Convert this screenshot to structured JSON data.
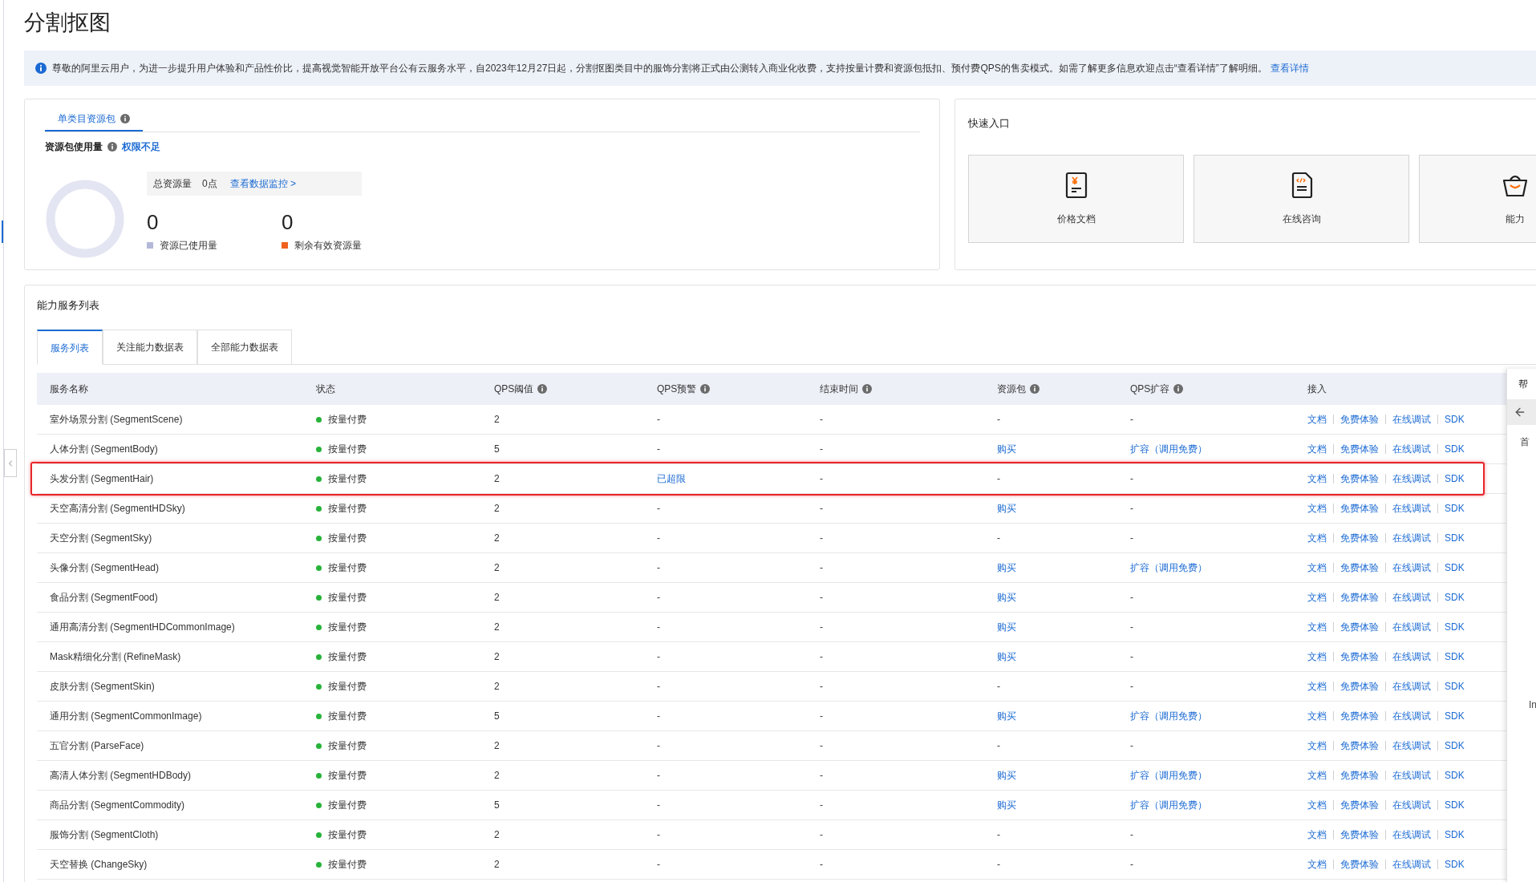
{
  "page_title": "分割抠图",
  "notice": {
    "text": "尊敬的阿里云用户，为进一步提升用户体验和产品性价比，提高视觉智能开放平台公有云服务水平，自2023年12月27日起，分割抠图类目中的服饰分割将正式由公测转入商业化收费，支持按量计费和资源包抵扣、预付费QPS的售卖模式。如需了解更多信息欢迎点击“查看详情”了解明细。",
    "link": "查看详情"
  },
  "resource_card": {
    "tabs": [
      {
        "label": "单类目资源包",
        "selected": true
      }
    ],
    "usage_label": "资源包使用量",
    "permission_link": "权限不足",
    "total_label": "总资源量",
    "total_value": "0点",
    "monitor_link": "查看数据监控 >",
    "used_value": "0",
    "used_label": "资源已使用量",
    "remaining_value": "0",
    "remaining_label": "剩余有效资源量"
  },
  "quick_entry": {
    "title": "快速入口",
    "tiles": [
      {
        "label": "价格文档",
        "kind": "price"
      },
      {
        "label": "在线咨询",
        "kind": "code"
      },
      {
        "label": "能力",
        "kind": "basket"
      }
    ]
  },
  "service_list": {
    "title": "能力服务列表",
    "tabs": [
      {
        "label": "服务列表",
        "selected": true
      },
      {
        "label": "关注能力数据表",
        "selected": false
      },
      {
        "label": "全部能力数据表",
        "selected": false
      }
    ],
    "columns": [
      {
        "label": "服务名称",
        "kind": "plain"
      },
      {
        "label": "状态",
        "kind": "plain"
      },
      {
        "label": "QPS阈值",
        "kind": "info"
      },
      {
        "label": "QPS预警",
        "kind": "info"
      },
      {
        "label": "结束时间",
        "kind": "info"
      },
      {
        "label": "资源包",
        "kind": "info"
      },
      {
        "label": "QPS扩容",
        "kind": "info"
      },
      {
        "label": "接入",
        "kind": "plain"
      }
    ],
    "rows": [
      {
        "name": "室外场景分割 (SegmentScene)",
        "status": "按量付费",
        "qps": "2",
        "warning": {
          "text": "-",
          "link": false
        },
        "end_time": "-",
        "package": {
          "text": "-",
          "link": false
        },
        "expand": {
          "text": "-",
          "link": false
        },
        "access": [
          "文档",
          "免费体验",
          "在线调试",
          "SDK"
        ],
        "highlighted": false
      },
      {
        "name": "人体分割 (SegmentBody)",
        "status": "按量付费",
        "qps": "5",
        "warning": {
          "text": "-",
          "link": false
        },
        "end_time": "-",
        "package": {
          "text": "购买",
          "link": true
        },
        "expand": {
          "text": "扩容（调用免费）",
          "link": true
        },
        "access": [
          "文档",
          "免费体验",
          "在线调试",
          "SDK"
        ],
        "highlighted": false
      },
      {
        "name": "头发分割 (SegmentHair)",
        "status": "按量付费",
        "qps": "2",
        "warning": {
          "text": "已超限",
          "link": true
        },
        "end_time": "-",
        "package": {
          "text": "-",
          "link": false
        },
        "expand": {
          "text": "-",
          "link": false
        },
        "access": [
          "文档",
          "免费体验",
          "在线调试",
          "SDK"
        ],
        "highlighted": true
      },
      {
        "name": "天空高清分割 (SegmentHDSky)",
        "status": "按量付费",
        "qps": "2",
        "warning": {
          "text": "-",
          "link": false
        },
        "end_time": "-",
        "package": {
          "text": "购买",
          "link": true
        },
        "expand": {
          "text": "-",
          "link": false
        },
        "access": [
          "文档",
          "免费体验",
          "在线调试",
          "SDK"
        ],
        "highlighted": false
      },
      {
        "name": "天空分割 (SegmentSky)",
        "status": "按量付费",
        "qps": "2",
        "warning": {
          "text": "-",
          "link": false
        },
        "end_time": "-",
        "package": {
          "text": "-",
          "link": false
        },
        "expand": {
          "text": "-",
          "link": false
        },
        "access": [
          "文档",
          "免费体验",
          "在线调试",
          "SDK"
        ],
        "highlighted": false
      },
      {
        "name": "头像分割 (SegmentHead)",
        "status": "按量付费",
        "qps": "2",
        "warning": {
          "text": "-",
          "link": false
        },
        "end_time": "-",
        "package": {
          "text": "购买",
          "link": true
        },
        "expand": {
          "text": "扩容（调用免费）",
          "link": true
        },
        "access": [
          "文档",
          "免费体验",
          "在线调试",
          "SDK"
        ],
        "highlighted": false
      },
      {
        "name": "食品分割 (SegmentFood)",
        "status": "按量付费",
        "qps": "2",
        "warning": {
          "text": "-",
          "link": false
        },
        "end_time": "-",
        "package": {
          "text": "购买",
          "link": true
        },
        "expand": {
          "text": "-",
          "link": false
        },
        "access": [
          "文档",
          "免费体验",
          "在线调试",
          "SDK"
        ],
        "highlighted": false
      },
      {
        "name": "通用高清分割 (SegmentHDCommonImage)",
        "status": "按量付费",
        "qps": "2",
        "warning": {
          "text": "-",
          "link": false
        },
        "end_time": "-",
        "package": {
          "text": "购买",
          "link": true
        },
        "expand": {
          "text": "-",
          "link": false
        },
        "access": [
          "文档",
          "免费体验",
          "在线调试",
          "SDK"
        ],
        "highlighted": false
      },
      {
        "name": "Mask精细化分割 (RefineMask)",
        "status": "按量付费",
        "qps": "2",
        "warning": {
          "text": "-",
          "link": false
        },
        "end_time": "-",
        "package": {
          "text": "购买",
          "link": true
        },
        "expand": {
          "text": "-",
          "link": false
        },
        "access": [
          "文档",
          "免费体验",
          "在线调试",
          "SDK"
        ],
        "highlighted": false
      },
      {
        "name": "皮肤分割 (SegmentSkin)",
        "status": "按量付费",
        "qps": "2",
        "warning": {
          "text": "-",
          "link": false
        },
        "end_time": "-",
        "package": {
          "text": "-",
          "link": false
        },
        "expand": {
          "text": "-",
          "link": false
        },
        "access": [
          "文档",
          "免费体验",
          "在线调试",
          "SDK"
        ],
        "highlighted": false
      },
      {
        "name": "通用分割 (SegmentCommonImage)",
        "status": "按量付费",
        "qps": "5",
        "warning": {
          "text": "-",
          "link": false
        },
        "end_time": "-",
        "package": {
          "text": "购买",
          "link": true
        },
        "expand": {
          "text": "扩容（调用免费）",
          "link": true
        },
        "access": [
          "文档",
          "免费体验",
          "在线调试",
          "SDK"
        ],
        "highlighted": false
      },
      {
        "name": "五官分割 (ParseFace)",
        "status": "按量付费",
        "qps": "2",
        "warning": {
          "text": "-",
          "link": false
        },
        "end_time": "-",
        "package": {
          "text": "-",
          "link": false
        },
        "expand": {
          "text": "-",
          "link": false
        },
        "access": [
          "文档",
          "免费体验",
          "在线调试",
          "SDK"
        ],
        "highlighted": false
      },
      {
        "name": "高清人体分割 (SegmentHDBody)",
        "status": "按量付费",
        "qps": "2",
        "warning": {
          "text": "-",
          "link": false
        },
        "end_time": "-",
        "package": {
          "text": "购买",
          "link": true
        },
        "expand": {
          "text": "扩容（调用免费）",
          "link": true
        },
        "access": [
          "文档",
          "免费体验",
          "在线调试",
          "SDK"
        ],
        "highlighted": false
      },
      {
        "name": "商品分割 (SegmentCommodity)",
        "status": "按量付费",
        "qps": "5",
        "warning": {
          "text": "-",
          "link": false
        },
        "end_time": "-",
        "package": {
          "text": "购买",
          "link": true
        },
        "expand": {
          "text": "扩容（调用免费）",
          "link": true
        },
        "access": [
          "文档",
          "免费体验",
          "在线调试",
          "SDK"
        ],
        "highlighted": false
      },
      {
        "name": "服饰分割 (SegmentCloth)",
        "status": "按量付费",
        "qps": "2",
        "warning": {
          "text": "-",
          "link": false
        },
        "end_time": "-",
        "package": {
          "text": "-",
          "link": false
        },
        "expand": {
          "text": "-",
          "link": false
        },
        "access": [
          "文档",
          "免费体验",
          "在线调试",
          "SDK"
        ],
        "highlighted": false
      },
      {
        "name": "天空替换 (ChangeSky)",
        "status": "按量付费",
        "qps": "2",
        "warning": {
          "text": "-",
          "link": false
        },
        "end_time": "-",
        "package": {
          "text": "-",
          "link": false
        },
        "expand": {
          "text": "-",
          "link": false
        },
        "access": [
          "文档",
          "免费体验",
          "在线调试",
          "SDK"
        ],
        "highlighted": false
      }
    ]
  },
  "help_panel": {
    "title": "帮",
    "home": "首",
    "bottom_text": "In"
  }
}
